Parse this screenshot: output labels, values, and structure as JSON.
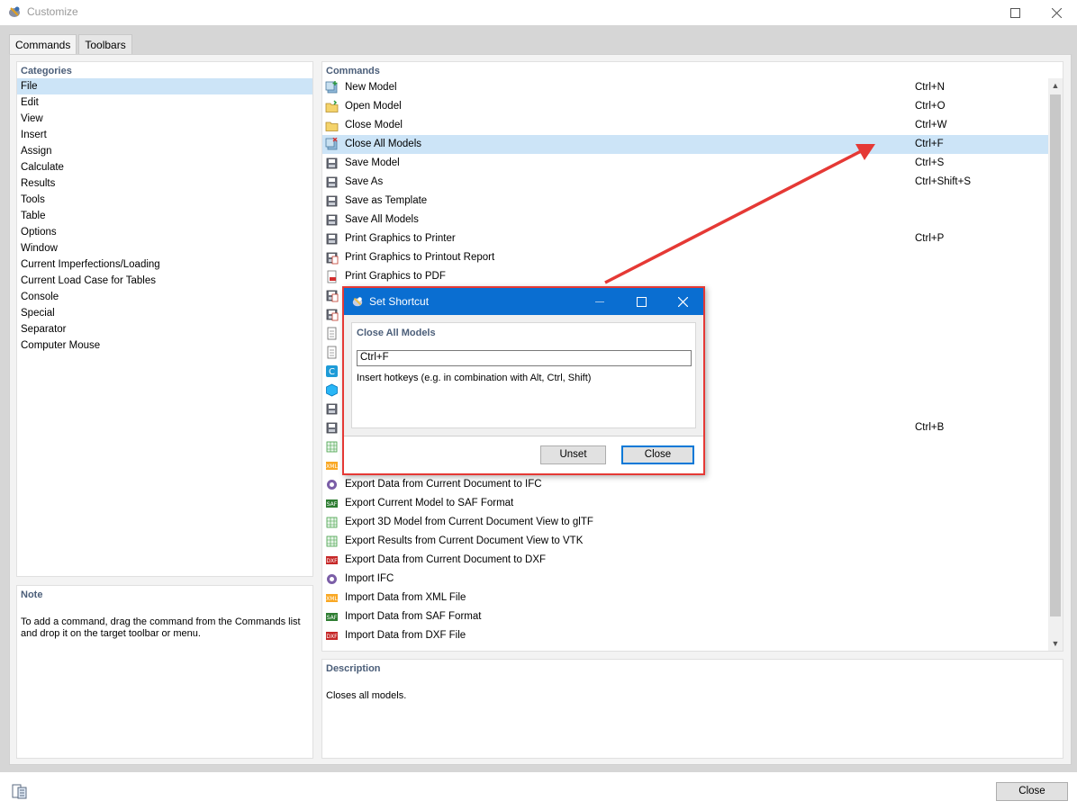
{
  "window": {
    "title": "Customize"
  },
  "tabs": [
    {
      "label": "Commands",
      "active": true
    },
    {
      "label": "Toolbars",
      "active": false
    }
  ],
  "categories": {
    "title": "Categories",
    "items": [
      "File",
      "Edit",
      "View",
      "Insert",
      "Assign",
      "Calculate",
      "Results",
      "Tools",
      "Table",
      "Options",
      "Window",
      "Current Imperfections/Loading",
      "Current Load Case for Tables",
      "Console",
      "Special",
      "Separator",
      "Computer Mouse"
    ],
    "selected": "File"
  },
  "commands": {
    "title": "Commands",
    "rows": [
      {
        "label": "New Model",
        "key": "Ctrl+N",
        "icon": "new-model-icon"
      },
      {
        "label": "Open Model",
        "key": "Ctrl+O",
        "icon": "open-folder-icon"
      },
      {
        "label": "Close Model",
        "key": "Ctrl+W",
        "icon": "close-folder-icon"
      },
      {
        "label": "Close All Models",
        "key": "Ctrl+F",
        "icon": "close-all-icon",
        "selected": true
      },
      {
        "label": "Save Model",
        "key": "Ctrl+S",
        "icon": "save-icon"
      },
      {
        "label": "Save As",
        "key": "Ctrl+Shift+S",
        "icon": "save-as-icon"
      },
      {
        "label": "Save as Template",
        "key": "",
        "icon": "save-template-icon"
      },
      {
        "label": "Save All Models",
        "key": "",
        "icon": "save-all-icon"
      },
      {
        "label": "Print Graphics to Printer",
        "key": "Ctrl+P",
        "icon": "printer-icon"
      },
      {
        "label": "Print Graphics to Printout Report",
        "key": "",
        "icon": "printout-report-icon"
      },
      {
        "label": "Print Graphics to PDF",
        "key": "",
        "icon": "pdf-icon"
      },
      {
        "label": "",
        "key": "",
        "icon": "pdf-print-icon"
      },
      {
        "label": "",
        "key": "",
        "icon": "print-report-icon"
      },
      {
        "label": "",
        "key": "",
        "icon": "export-icon"
      },
      {
        "label": "",
        "key": "",
        "icon": "report-icon"
      },
      {
        "label": "",
        "key": "",
        "icon": "cloud-c-icon"
      },
      {
        "label": "",
        "key": "",
        "icon": "cube-icon"
      },
      {
        "label": "",
        "key": "",
        "icon": "block-icon"
      },
      {
        "label": "",
        "key": "Ctrl+B",
        "icon": "batch-icon"
      },
      {
        "label": "",
        "key": "",
        "icon": "grid-export-icon"
      },
      {
        "label": "",
        "key": "",
        "icon": "xml-export-icon"
      },
      {
        "label": "Export Data from Current Document to IFC",
        "key": "",
        "icon": "ifc-export-icon"
      },
      {
        "label": "Export Current Model to SAF Format",
        "key": "",
        "icon": "saf-export-icon"
      },
      {
        "label": "Export 3D Model from Current Document View to glTF",
        "key": "",
        "icon": "gltf-export-icon"
      },
      {
        "label": "Export Results from Current Document View to VTK",
        "key": "",
        "icon": "vtk-export-icon"
      },
      {
        "label": "Export Data from Current Document to DXF",
        "key": "",
        "icon": "dxf-export-icon"
      },
      {
        "label": "Import IFC",
        "key": "",
        "icon": "ifc-import-icon"
      },
      {
        "label": "Import Data from XML File",
        "key": "",
        "icon": "xml-import-icon"
      },
      {
        "label": "Import Data from SAF Format",
        "key": "",
        "icon": "saf-import-icon"
      },
      {
        "label": "Import Data from DXF File",
        "key": "",
        "icon": "dxf-import-icon"
      }
    ]
  },
  "note": {
    "title": "Note",
    "text": "To add a command, drag the command from the Commands list and drop it on the target toolbar or menu."
  },
  "description": {
    "title": "Description",
    "text": "Closes all models."
  },
  "footer": {
    "close_label": "Close"
  },
  "dialog": {
    "title": "Set Shortcut",
    "panel_title": "Close All Models",
    "input_value": "Ctrl+F",
    "hint": "Insert hotkeys (e.g. in combination with Alt, Ctrl, Shift)",
    "unset_label": "Unset",
    "close_label": "Close"
  },
  "colors": {
    "accent": "#0a6ed1",
    "selection": "#cce4f7",
    "annotation": "#e53935",
    "heading": "#4b5e79"
  }
}
